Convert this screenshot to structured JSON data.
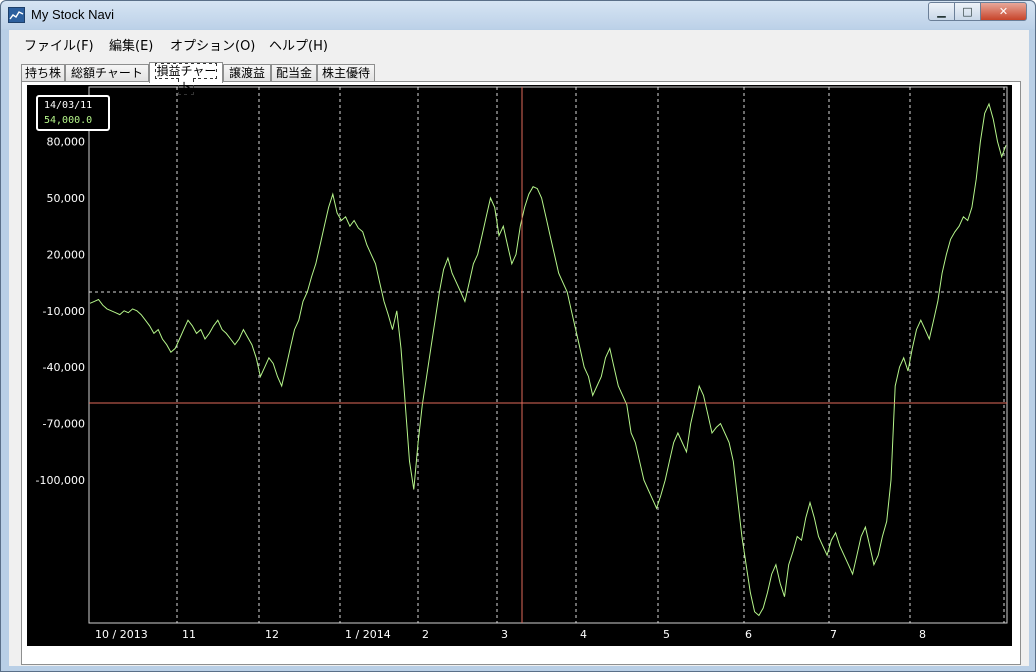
{
  "window": {
    "title": "My Stock Navi",
    "icon": "chart-icon",
    "controls": {
      "minimize": "▁",
      "maximize": "□",
      "close": "✕"
    }
  },
  "menu": [
    {
      "label": "ファイル(F)"
    },
    {
      "label": "編集(E)"
    },
    {
      "label": "オプション(O)"
    },
    {
      "label": "ヘルプ(H)"
    }
  ],
  "tabs": [
    {
      "label": "持ち株",
      "active": false
    },
    {
      "label": "総額チャート",
      "active": false
    },
    {
      "label": "損益チャート",
      "active": true
    },
    {
      "label": "譲渡益",
      "active": false
    },
    {
      "label": "配当金",
      "active": false
    },
    {
      "label": "株主優待",
      "active": false
    }
  ],
  "readout": {
    "date": "14/03/11",
    "value": "54,000.0"
  },
  "colors": {
    "background": "#000000",
    "line": "#b5f58a",
    "crosshair": "#e06a5a",
    "grid": "#ffffff",
    "readout_value": "#b5f58a"
  },
  "chart_data": {
    "type": "line",
    "title": "",
    "xlabel": "",
    "ylabel": "",
    "x_tick_labels": [
      "10 / 2013",
      "11",
      "12",
      "1 / 2014",
      "2",
      "3",
      "4",
      "5",
      "6",
      "7",
      "8"
    ],
    "y_tick_labels": [
      "80,000",
      "50,000",
      "20,000",
      "-10,000",
      "-40,000",
      "-70,000",
      "-100,000"
    ],
    "y_ticks": [
      80000,
      50000,
      20000,
      -10000,
      -40000,
      -70000,
      -100000
    ],
    "ylim": [
      -176000,
      109000
    ],
    "grid": "vertical dashed at month boundaries, horizontal dashed at 0",
    "crosshair": {
      "x": "14/03/11",
      "y": -59000
    },
    "series": [
      {
        "values": [
          -6000,
          -5000,
          -4000,
          -7000,
          -9000,
          -10000,
          -11000,
          -12000,
          -10000,
          -11000,
          -9000,
          -10000,
          -12000,
          -15000,
          -18000,
          -22000,
          -20000,
          -25000,
          -28000,
          -32000,
          -30000,
          -25000,
          -20000,
          -15000,
          -18000,
          -22000,
          -20000,
          -25000,
          -22000,
          -18000,
          -15000,
          -20000,
          -22000,
          -25000,
          -28000,
          -25000,
          -20000,
          -24000,
          -28000,
          -35000,
          -45000,
          -40000,
          -35000,
          -38000,
          -45000,
          -50000,
          -40000,
          -30000,
          -20000,
          -15000,
          -5000,
          0,
          8000,
          15000,
          25000,
          35000,
          45000,
          52000,
          42000,
          38000,
          40000,
          35000,
          38000,
          34000,
          32000,
          25000,
          20000,
          15000,
          5000,
          -5000,
          -12000,
          -20000,
          -10000,
          -30000,
          -60000,
          -90000,
          -105000,
          -80000,
          -60000,
          -45000,
          -30000,
          -15000,
          0,
          12000,
          18000,
          10000,
          5000,
          0,
          -5000,
          5000,
          15000,
          20000,
          30000,
          40000,
          50000,
          45000,
          30000,
          35000,
          25000,
          15000,
          20000,
          35000,
          45000,
          52000,
          56000,
          55000,
          50000,
          40000,
          30000,
          20000,
          10000,
          5000,
          0,
          -10000,
          -20000,
          -30000,
          -40000,
          -45000,
          -55000,
          -50000,
          -45000,
          -35000,
          -30000,
          -40000,
          -50000,
          -55000,
          -60000,
          -75000,
          -80000,
          -90000,
          -100000,
          -105000,
          -110000,
          -115000,
          -108000,
          -100000,
          -90000,
          -80000,
          -75000,
          -80000,
          -85000,
          -70000,
          -60000,
          -50000,
          -55000,
          -65000,
          -75000,
          -72000,
          -70000,
          -75000,
          -80000,
          -90000,
          -110000,
          -130000,
          -145000,
          -160000,
          -170000,
          -172000,
          -168000,
          -160000,
          -150000,
          -145000,
          -155000,
          -162000,
          -145000,
          -138000,
          -130000,
          -132000,
          -120000,
          -112000,
          -120000,
          -130000,
          -135000,
          -140000,
          -132000,
          -128000,
          -135000,
          -140000,
          -145000,
          -150000,
          -140000,
          -130000,
          -125000,
          -135000,
          -145000,
          -140000,
          -130000,
          -122000,
          -100000,
          -50000,
          -40000,
          -35000,
          -42000,
          -30000,
          -20000,
          -15000,
          -20000,
          -25000,
          -15000,
          -5000,
          10000,
          20000,
          28000,
          32000,
          35000,
          40000,
          38000,
          45000,
          60000,
          80000,
          95000,
          100000,
          92000,
          80000,
          72000,
          78000
        ]
      }
    ]
  }
}
